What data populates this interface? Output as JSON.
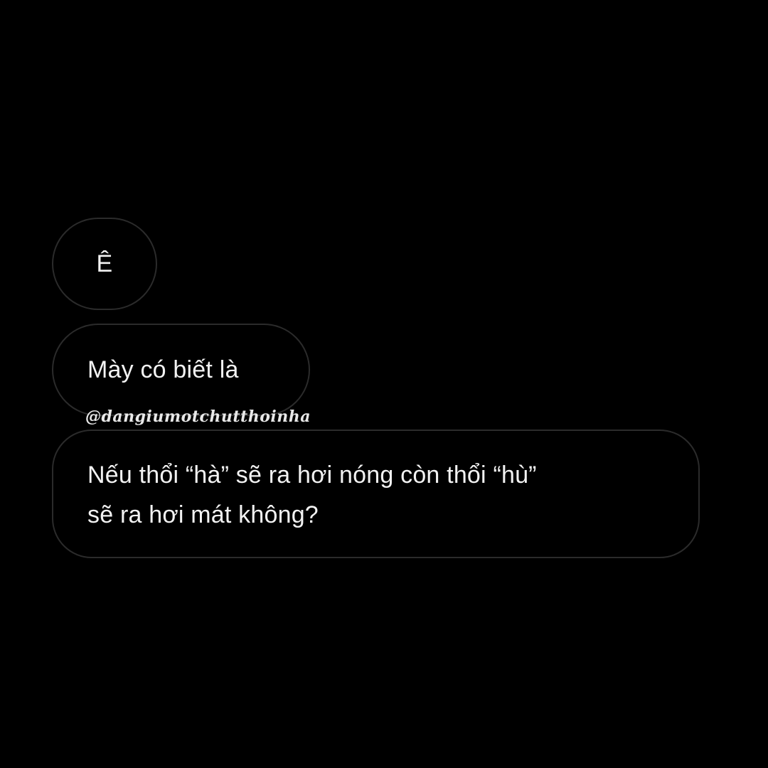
{
  "messages": [
    {
      "lines": [
        "Ê"
      ]
    },
    {
      "lines": [
        "Mày có biết là"
      ]
    },
    {
      "lines": [
        "Nếu thổi “hà” sẽ ra hơi nóng còn thổi “hù”",
        "sẽ ra hơi mát không?"
      ]
    }
  ],
  "watermark": "@dangiumotchutthoinha",
  "colors": {
    "background": "#000000",
    "bubble_border": "#2b2b2b",
    "text": "#f2f2f2"
  }
}
